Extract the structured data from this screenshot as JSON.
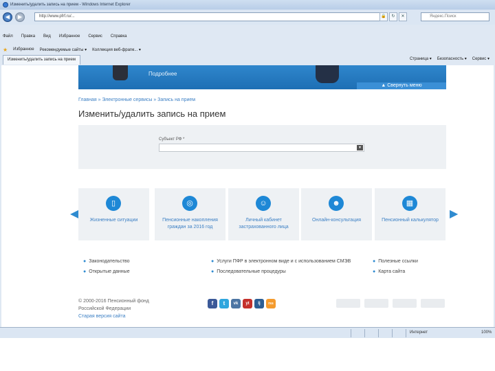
{
  "window": {
    "title": "Изменить/удалить запись на прием - Windows Internet Explorer"
  },
  "address": {
    "url": "http://www.pfrf.ru/...",
    "search_placeholder": "Яндекс.Поиск"
  },
  "menu": [
    "Файл",
    "Правка",
    "Вид",
    "Избранное",
    "Сервис",
    "Справка"
  ],
  "favorites": {
    "label": "Избранное",
    "items": [
      "Рекомендуемые сайты ▾",
      "Коллекция веб-фрагм... ▾"
    ]
  },
  "tab": {
    "label": "Изменить/удалить запись на прием"
  },
  "commands": [
    "Страница ▾",
    "Безопасность ▾",
    "Сервис ▾"
  ],
  "banner": {
    "more_text": "Подробнее",
    "collapse_label": "▲ Свернуть меню"
  },
  "breadcrumb": "Главная » Электронные сервисы » Запись на прием",
  "page_title": "Изменить/удалить запись на прием",
  "form": {
    "field_label": "Субъект РФ *",
    "field_value": ""
  },
  "tiles": [
    {
      "label": "Жизненные ситуации",
      "icon": "door-icon"
    },
    {
      "label": "Пенсионные накопления граждан за 2016 год",
      "icon": "coins-icon"
    },
    {
      "label": "Личный кабинет застрахованного лица",
      "icon": "person-icon"
    },
    {
      "label": "Онлайн-консультация",
      "icon": "consultant-icon"
    },
    {
      "label": "Пенсионный калькулятор",
      "icon": "calculator-icon"
    }
  ],
  "links": {
    "col1": [
      "Законодательство",
      "Открытые данные"
    ],
    "col2": [
      "Услуги ПФР в электронном виде и с использованием СМЭВ",
      "Последовательные процедуры"
    ],
    "col3": [
      "Полезные ссылки",
      "Карта сайта"
    ]
  },
  "footer": {
    "copyright": "© 2000-2016 Пенсионный фонд",
    "copyright2": "Российской Федерации",
    "old_site": "Старая версия сайта"
  },
  "social": [
    "f",
    "t",
    "vk",
    "yt",
    "lj",
    "rss"
  ],
  "status": {
    "zone": "Интернет",
    "zoom": "100%"
  },
  "colors": {
    "accent": "#1e88d6",
    "link": "#3b7fc4",
    "panel": "#eef1f4"
  }
}
